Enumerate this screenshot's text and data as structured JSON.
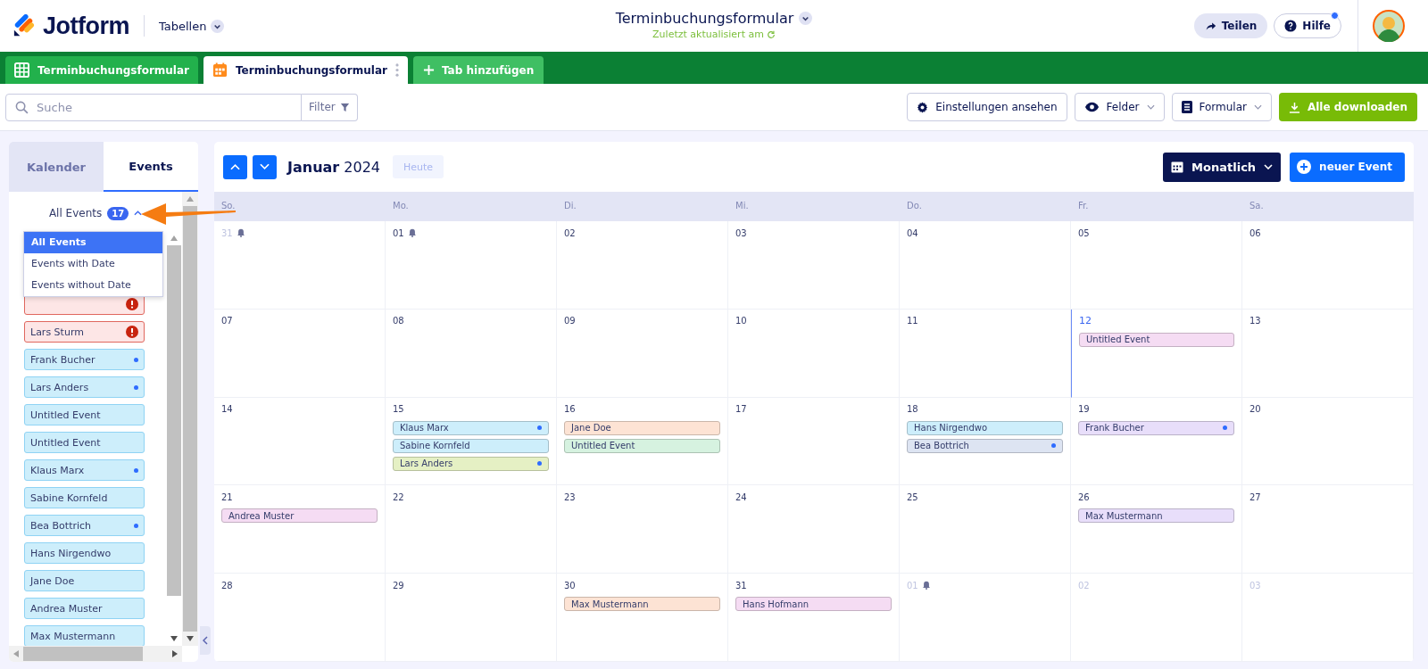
{
  "header": {
    "logo": "Jotform",
    "section_menu": "Tabellen",
    "title": "Terminbuchungsformular",
    "subtitle": "Zuletzt aktualisiert am",
    "share": "Teilen",
    "help": "Hilfe",
    "help_notification": true
  },
  "tabs": [
    {
      "label": "Terminbuchungsformular",
      "kind": "table",
      "selected": false
    },
    {
      "label": "Terminbuchungsformular",
      "kind": "calendar",
      "selected": true
    }
  ],
  "add_tab": "Tab hinzufügen",
  "toolbar": {
    "search_placeholder": "Suche",
    "filter": "Filter",
    "settings": "Einstellungen ansehen",
    "fields": "Felder",
    "form": "Formular",
    "download": "Alle downloaden"
  },
  "sidebar": {
    "tabs": [
      {
        "label": "Kalender",
        "selected": false
      },
      {
        "label": "Events",
        "selected": true
      }
    ],
    "filter_label": "All Events",
    "count": "17",
    "expanded": true,
    "filter_options": [
      {
        "label": "All Events",
        "selected": true
      },
      {
        "label": "Events with Date",
        "selected": false
      },
      {
        "label": "Events without Date",
        "selected": false
      }
    ],
    "events": [
      {
        "kind": "alert"
      },
      {
        "label": "Lars Sturm",
        "kind": "alert"
      },
      {
        "label": "Frank Bucher",
        "kind": "dot"
      },
      {
        "label": "Lars Anders",
        "kind": "dot"
      },
      {
        "label": "Untitled Event",
        "kind": "plain"
      },
      {
        "label": "Untitled Event",
        "kind": "plain"
      },
      {
        "label": "Klaus Marx",
        "kind": "dot"
      },
      {
        "label": "Sabine Kornfeld",
        "kind": "plain"
      },
      {
        "label": "Bea Bottrich",
        "kind": "dot"
      },
      {
        "label": "Hans Nirgendwo",
        "kind": "plain"
      },
      {
        "label": "Jane Doe",
        "kind": "plain"
      },
      {
        "label": "Andrea Muster",
        "kind": "plain"
      },
      {
        "label": "Max Mustermann",
        "kind": "plain"
      }
    ]
  },
  "calendar": {
    "month": "Januar",
    "year": "2024",
    "today_button": "Heute",
    "view": "Monatlich",
    "new_event": "neuer Event",
    "weekdays": [
      "So.",
      "Mo.",
      "Di.",
      "Mi.",
      "Do.",
      "Fr.",
      "Sa."
    ],
    "weeks": [
      [
        {
          "date": "31",
          "muted": true,
          "bell": true
        },
        {
          "date": "01",
          "muted": false,
          "bell": true
        },
        {
          "date": "02",
          "muted": false
        },
        {
          "date": "03",
          "muted": false
        },
        {
          "date": "04",
          "muted": false
        },
        {
          "date": "05",
          "muted": false
        },
        {
          "date": "06",
          "muted": false
        }
      ],
      [
        {
          "date": "07",
          "muted": false
        },
        {
          "date": "08",
          "muted": false
        },
        {
          "date": "09",
          "muted": false
        },
        {
          "date": "10",
          "muted": false
        },
        {
          "date": "11",
          "muted": false
        },
        {
          "date": "12",
          "muted": false,
          "today": true,
          "events": [
            {
              "label": "Untitled Event",
              "color": "#f5dcf3",
              "dot": false
            }
          ]
        },
        {
          "date": "13",
          "muted": false
        }
      ],
      [
        {
          "date": "14",
          "muted": false
        },
        {
          "date": "15",
          "muted": false,
          "events": [
            {
              "label": "Klaus Marx",
              "color": "#cdeefb",
              "dot": true
            },
            {
              "label": "Sabine Kornfeld",
              "color": "#cdeefb",
              "dot": false
            },
            {
              "label": "Lars Anders",
              "color": "#e5f0c4",
              "dot": true
            }
          ]
        },
        {
          "date": "16",
          "muted": false,
          "events": [
            {
              "label": "Jane Doe",
              "color": "#fde3d4",
              "dot": false
            },
            {
              "label": "Untitled Event",
              "color": "#d6f2e0",
              "dot": false
            }
          ]
        },
        {
          "date": "17",
          "muted": false
        },
        {
          "date": "18",
          "muted": false,
          "events": [
            {
              "label": "Hans Nirgendwo",
              "color": "#cdeefb",
              "dot": false
            },
            {
              "label": "Bea Bottrich",
              "color": "#dde4f2",
              "dot": true
            }
          ]
        },
        {
          "date": "19",
          "muted": false,
          "events": [
            {
              "label": "Frank Bucher",
              "color": "#e8defa",
              "dot": true
            }
          ]
        },
        {
          "date": "20",
          "muted": false
        }
      ],
      [
        {
          "date": "21",
          "muted": false,
          "events": [
            {
              "label": "Andrea Muster",
              "color": "#f5dcf3",
              "dot": false
            }
          ]
        },
        {
          "date": "22",
          "muted": false
        },
        {
          "date": "23",
          "muted": false
        },
        {
          "date": "24",
          "muted": false
        },
        {
          "date": "25",
          "muted": false
        },
        {
          "date": "26",
          "muted": false,
          "events": [
            {
              "label": "Max Mustermann",
              "color": "#e8defa",
              "dot": false
            }
          ]
        },
        {
          "date": "27",
          "muted": false
        }
      ],
      [
        {
          "date": "28",
          "muted": false
        },
        {
          "date": "29",
          "muted": false
        },
        {
          "date": "30",
          "muted": false,
          "events": [
            {
              "label": "Max Mustermann",
              "color": "#fde3d4",
              "dot": false
            }
          ]
        },
        {
          "date": "31",
          "muted": false,
          "events": [
            {
              "label": "Hans Hofmann",
              "color": "#f5dcf3",
              "dot": false
            }
          ]
        },
        {
          "date": "01",
          "muted": true,
          "bell": true
        },
        {
          "date": "02",
          "muted": true
        },
        {
          "date": "03",
          "muted": true
        }
      ]
    ]
  }
}
